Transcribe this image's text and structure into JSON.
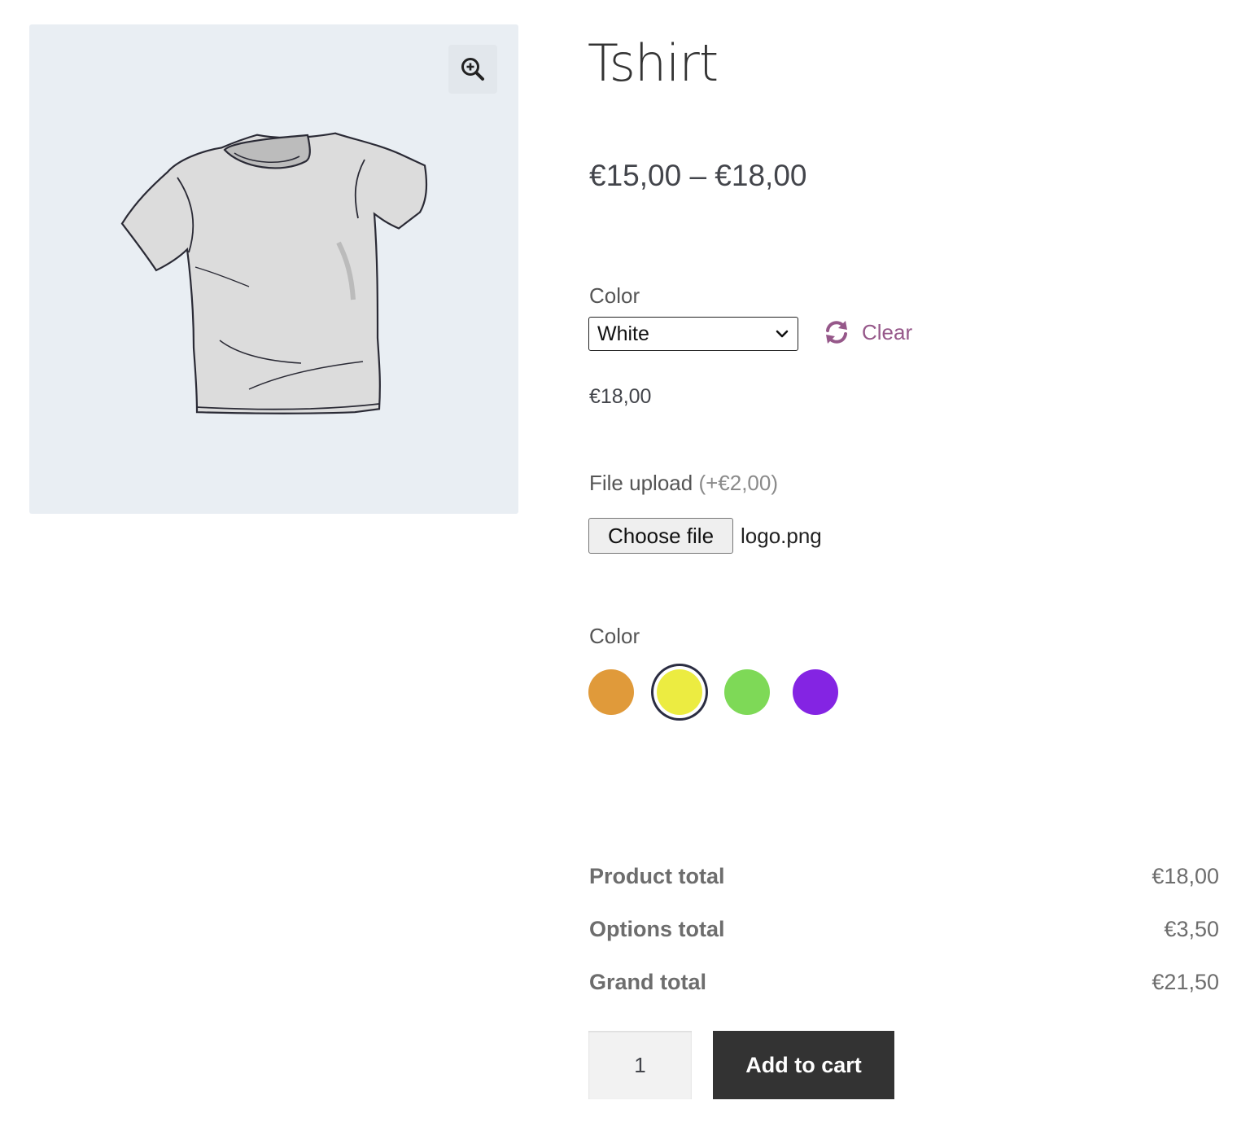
{
  "product": {
    "title": "Tshirt",
    "price_range": "€15,00 – €18,00"
  },
  "gallery": {
    "zoom_icon": "zoom-in-icon",
    "image": "tshirt-illustration"
  },
  "variation": {
    "label": "Color",
    "selected": "White",
    "clear_label": "Clear",
    "clear_icon": "refresh-icon",
    "price": "€18,00"
  },
  "file_upload": {
    "label": "File upload",
    "extra": "(+€2,00)",
    "button_label": "Choose file",
    "file_name": "logo.png"
  },
  "color_option": {
    "label": "Color",
    "swatches": [
      {
        "color": "#e09a3a",
        "selected": false
      },
      {
        "color": "#ecec41",
        "selected": true
      },
      {
        "color": "#7ed957",
        "selected": false
      },
      {
        "color": "#8424e3",
        "selected": false
      }
    ]
  },
  "totals": {
    "product_label": "Product total",
    "product_value": "€18,00",
    "options_label": "Options total",
    "options_value": "€3,50",
    "grand_label": "Grand total",
    "grand_value": "€21,50"
  },
  "cart": {
    "quantity": "1",
    "add_label": "Add to cart"
  },
  "colors": {
    "accent": "#96588a",
    "button_bg": "#333333"
  }
}
